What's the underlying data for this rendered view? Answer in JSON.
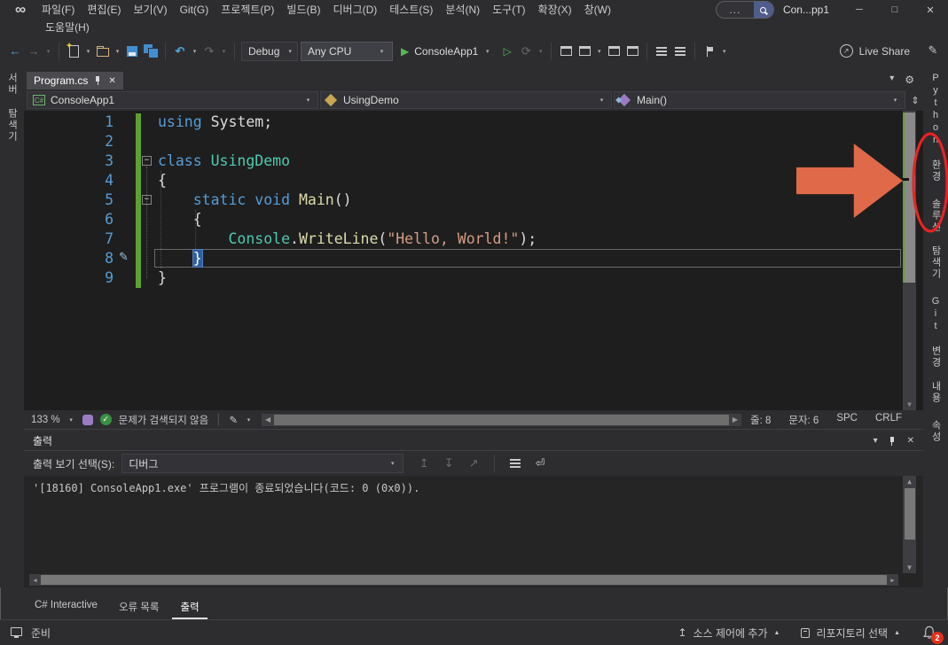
{
  "window": {
    "title": "Con...pp1",
    "search_text": "..."
  },
  "menu": {
    "row1": [
      "파일(F)",
      "편집(E)",
      "보기(V)",
      "Git(G)",
      "프로젝트(P)",
      "빌드(B)",
      "디버그(D)",
      "테스트(S)",
      "분석(N)",
      "도구(T)",
      "확장(X)",
      "창(W)"
    ],
    "row2": [
      "도움말(H)"
    ]
  },
  "toolbar": {
    "configuration": "Debug",
    "platform": "Any CPU",
    "startup_project": "ConsoleApp1",
    "live_share": "Live Share"
  },
  "left_strip": {
    "tabs": [
      "서버 탐색기"
    ]
  },
  "right_strip": {
    "tabs": [
      "Python 환경",
      "솔루션 탐색기",
      "Git 변경 내용",
      "속성"
    ]
  },
  "document_tab": {
    "title": "Program.cs"
  },
  "navbar": {
    "project": "ConsoleApp1",
    "type": "UsingDemo",
    "member": "Main()"
  },
  "editor": {
    "line_numbers": [
      "1",
      "2",
      "3",
      "4",
      "5",
      "6",
      "7",
      "8",
      "9"
    ],
    "lines": [
      {
        "tokens": [
          {
            "c": "kw",
            "t": "using"
          },
          {
            "c": "pln",
            "t": " System;"
          }
        ]
      },
      {
        "tokens": []
      },
      {
        "tokens": [
          {
            "c": "kw",
            "t": "class"
          },
          {
            "c": "pln",
            "t": " "
          },
          {
            "c": "typ",
            "t": "UsingDemo"
          }
        ]
      },
      {
        "tokens": [
          {
            "c": "pln",
            "t": "{"
          }
        ]
      },
      {
        "tokens": [
          {
            "c": "pln",
            "t": "    "
          },
          {
            "c": "kw",
            "t": "static"
          },
          {
            "c": "pln",
            "t": " "
          },
          {
            "c": "kw",
            "t": "void"
          },
          {
            "c": "pln",
            "t": " "
          },
          {
            "c": "mth",
            "t": "Main"
          },
          {
            "c": "pln",
            "t": "()"
          }
        ]
      },
      {
        "tokens": [
          {
            "c": "pln",
            "t": "    {"
          }
        ]
      },
      {
        "tokens": [
          {
            "c": "pln",
            "t": "        "
          },
          {
            "c": "typ",
            "t": "Console"
          },
          {
            "c": "pln",
            "t": "."
          },
          {
            "c": "mth",
            "t": "WriteLine"
          },
          {
            "c": "pln",
            "t": "("
          },
          {
            "c": "str",
            "t": "\"Hello, World!\""
          },
          {
            "c": "pln",
            "t": ");"
          }
        ]
      },
      {
        "tokens": [
          {
            "c": "pln",
            "t": "    "
          },
          {
            "c": "sel",
            "t": "}"
          }
        ]
      },
      {
        "tokens": [
          {
            "c": "pln",
            "t": "}"
          }
        ]
      }
    ]
  },
  "editor_status": {
    "zoom": "133 %",
    "health_text": "문제가 검색되지 않음",
    "line": "줄: 8",
    "column": "문자: 6",
    "insert_mode": "SPC",
    "line_ending": "CRLF"
  },
  "output": {
    "title": "출력",
    "source_label": "출력 보기 선택(S):",
    "source_value": "디버그",
    "lines": [
      "'[18160] ConsoleApp1.exe' 프로그램이 종료되었습니다(코드: 0 (0x0))."
    ]
  },
  "bottom_tabs": {
    "tabs": [
      "C# Interactive",
      "오류 목록",
      "출력"
    ],
    "active_index": 2
  },
  "statusbar": {
    "ready": "준비",
    "add_to_source_control": "소스 제어에 추가",
    "select_repository": "리포지토리 선택",
    "notification_count": "2"
  },
  "annotations": {
    "arrow_color": "#e0694a",
    "circle_color": "#ee2222",
    "circle_target": "솔루션 탐색기"
  }
}
